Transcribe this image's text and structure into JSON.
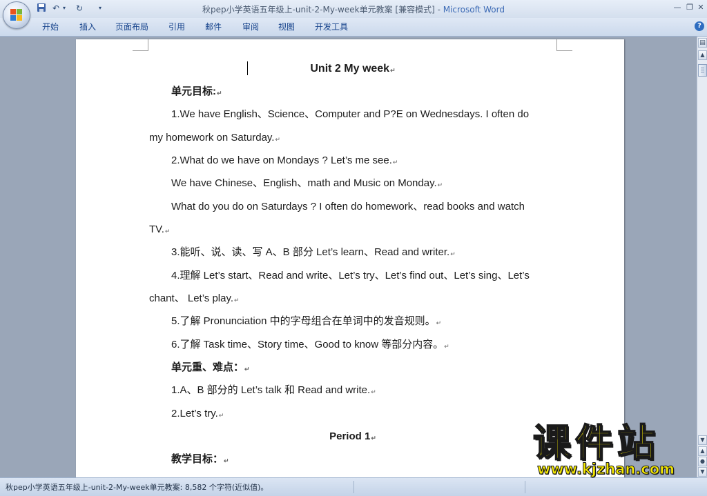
{
  "window": {
    "title_doc": "秋pep小学英语五年级上-unit-2-My-week单元教案 [兼容模式] - ",
    "title_app": "Microsoft Word",
    "qat_undo": "↶",
    "qat_redo": "↻",
    "qat_more": "▾",
    "minimize": "—",
    "restore": "❐",
    "close": "✕"
  },
  "ribbon": {
    "tabs": [
      "开始",
      "插入",
      "页面布局",
      "引用",
      "邮件",
      "审阅",
      "视图",
      "开发工具"
    ],
    "help": "?"
  },
  "document": {
    "lines": [
      "Unit 2 My week",
      "单元目标:",
      "1.We have English、Science、Computer and P?E on Wednesdays. I often do",
      "my homework on Saturday.",
      "2.What do we have on Mondays ? Let’s me see.",
      "We have Chinese、English、math and Music on Monday.",
      "What do you do on Saturdays ? I often do homework、read books and watch",
      "TV.",
      "3.能听、说、读、写 A、B 部分 Let’s learn、Read and writer.",
      "4.理解 Let’s start、Read and write、Let’s try、Let’s find out、Let’s sing、Let’s",
      "chant、 Let’s play.",
      "5.了解 Pronunciation 中的字母组合在单词中的发音规则。",
      "6.了解 Task time、Story time、Good to know 等部分内容。",
      "单元重、难点：",
      "1.A、B 部分的 Let’s talk  和 Read and write.",
      "2.Let’s try.",
      "Period 1",
      "教学目标："
    ]
  },
  "statusbar": {
    "text": "秋pep小学英语五年级上-unit-2-My-week单元教案: 8,582 个字符(近似值)。"
  },
  "watermark": {
    "cn": "课件站",
    "url": "www.kjzhan.com"
  }
}
